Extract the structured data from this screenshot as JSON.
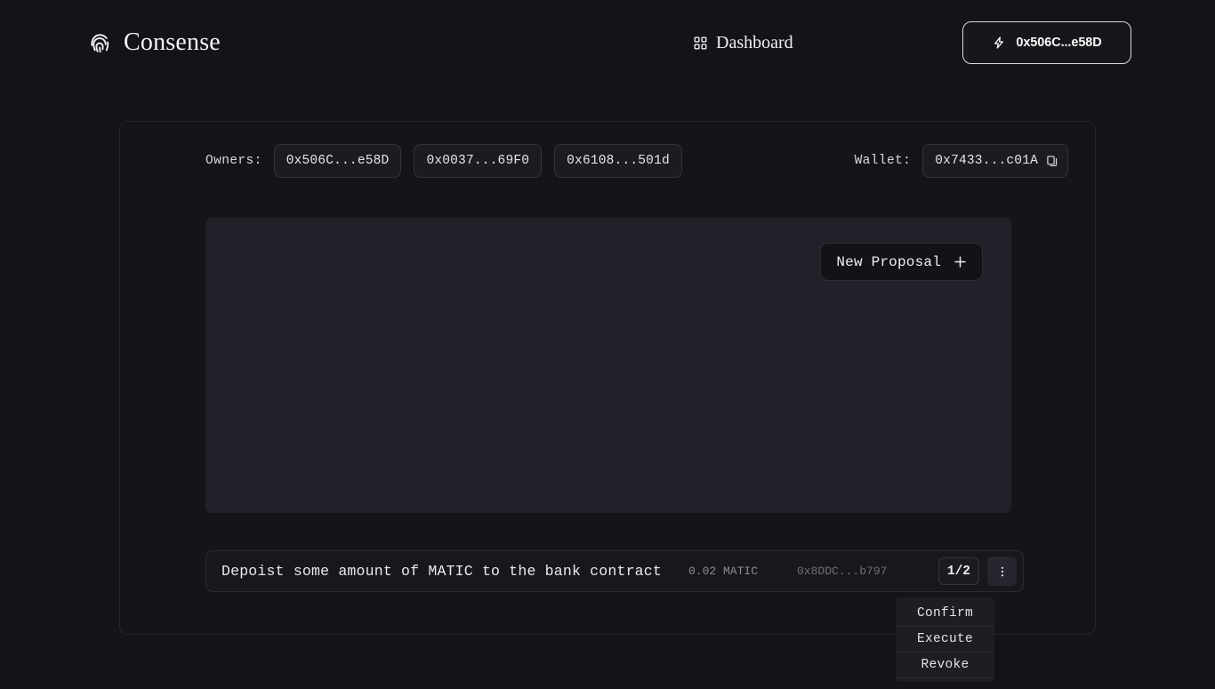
{
  "header": {
    "brand_name": "Consense",
    "brand_icon": "fingerprint-icon",
    "nav": {
      "label": "Dashboard",
      "icon": "grid-dashboard-icon"
    },
    "wallet_button": {
      "label": "0x506C...e58D",
      "icon": "lightning-bolt-icon"
    }
  },
  "card": {
    "owners": {
      "label": "Owners:",
      "addresses": [
        "0x506C...e58D",
        "0x0037...69F0",
        "0x6108...501d"
      ]
    },
    "wallet": {
      "label": "Wallet:",
      "address": "0x7433...c01A",
      "copy_icon": "copy-icon"
    },
    "panel": {
      "new_proposal_label": "New Proposal",
      "new_proposal_icon": "plus-icon"
    },
    "proposal": {
      "title": "Depoist some amount of MATIC to the bank contract",
      "amount": "0.02 MATIC",
      "destination": "0x8DDC...b797",
      "confirmations": "1/2",
      "menu_icon": "vertical-dots-icon"
    }
  },
  "dropdown": {
    "items": [
      {
        "label": "Confirm"
      },
      {
        "label": "Execute"
      },
      {
        "label": "Revoke"
      }
    ]
  },
  "colors": {
    "page_background": "#141418",
    "card_background": "#151519",
    "panel_background": "#212129",
    "accent_border": "#d9d9e0",
    "text_primary": "#e8e8ea",
    "text_muted": "#8c8c96"
  }
}
